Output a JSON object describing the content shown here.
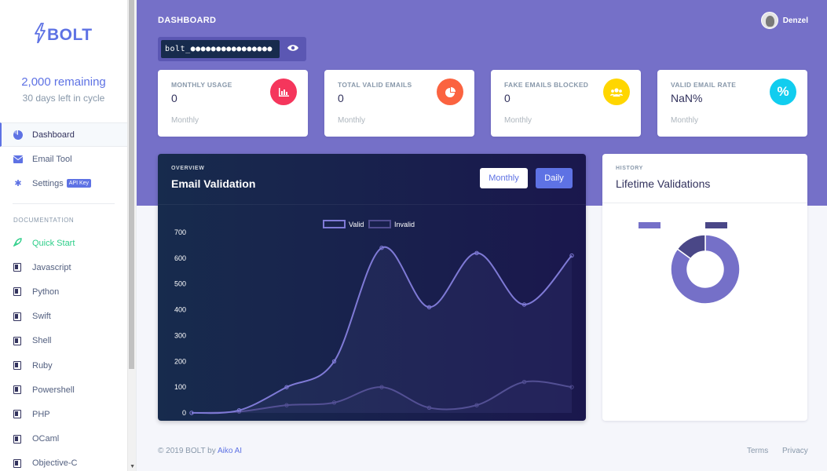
{
  "sidebar": {
    "logo_text": "BOLT",
    "remaining": "2,000 remaining",
    "cycle": "30 days left in cycle",
    "nav": [
      {
        "label": "Dashboard",
        "icon": "pie-chart-icon",
        "active": true
      },
      {
        "label": "Email Tool",
        "icon": "envelope-icon",
        "active": false
      },
      {
        "label": "Settings",
        "icon": "gear-icon",
        "active": false,
        "badge": "API Key"
      }
    ],
    "docs_heading": "DOCUMENTATION",
    "docs": [
      {
        "label": "Quick Start",
        "icon": "rocket-icon"
      },
      {
        "label": "Javascript",
        "icon": "book-icon"
      },
      {
        "label": "Python",
        "icon": "book-icon"
      },
      {
        "label": "Swift",
        "icon": "book-icon"
      },
      {
        "label": "Shell",
        "icon": "book-icon"
      },
      {
        "label": "Ruby",
        "icon": "book-icon"
      },
      {
        "label": "Powershell",
        "icon": "book-icon"
      },
      {
        "label": "PHP",
        "icon": "book-icon"
      },
      {
        "label": "OCaml",
        "icon": "book-icon"
      },
      {
        "label": "Objective-C",
        "icon": "book-icon"
      }
    ]
  },
  "header": {
    "title": "DASHBOARD",
    "user_name": "Denzel",
    "api_key_masked": "bolt_●●●●●●●●●●●●●●●●"
  },
  "stats": [
    {
      "label": "MONTHLY USAGE",
      "value": "0",
      "period": "Monthly",
      "icon": "bar-chart-icon",
      "color": "#f5365c"
    },
    {
      "label": "TOTAL VALID EMAILS",
      "value": "0",
      "period": "Monthly",
      "icon": "pie-chart-icon",
      "color": "#fb6340"
    },
    {
      "label": "FAKE EMAILS BLOCKED",
      "value": "0",
      "period": "Monthly",
      "icon": "users-icon",
      "color": "#ffd600"
    },
    {
      "label": "VALID EMAIL RATE",
      "value": "NaN%",
      "period": "Monthly",
      "icon": "percent-icon",
      "color": "#11cdef"
    }
  ],
  "overview": {
    "kicker": "OVERVIEW",
    "title": "Email Validation",
    "btn_monthly": "Monthly",
    "btn_daily": "Daily"
  },
  "history": {
    "kicker": "HISTORY",
    "title": "Lifetime Validations"
  },
  "chart_data": [
    {
      "type": "line",
      "title": "Email Validation",
      "ylim": [
        0,
        700
      ],
      "yticks": [
        0,
        100,
        200,
        300,
        400,
        500,
        600,
        700
      ],
      "x": [
        0,
        1,
        2,
        3,
        4,
        5,
        6,
        7,
        8
      ],
      "series": [
        {
          "name": "Valid",
          "color": "#7f7ad6",
          "values": [
            0,
            10,
            100,
            200,
            640,
            410,
            620,
            420,
            610
          ]
        },
        {
          "name": "Invalid",
          "color": "#504c8f",
          "values": [
            0,
            5,
            30,
            40,
            100,
            20,
            30,
            120,
            100
          ]
        }
      ],
      "grid": false,
      "legend": "top-center"
    },
    {
      "type": "pie",
      "title": "Lifetime Validations",
      "donut": true,
      "slices": [
        {
          "name": "",
          "value": 85,
          "color": "#7570c8"
        },
        {
          "name": "",
          "value": 15,
          "color": "#4a4787"
        }
      ]
    }
  ],
  "footer": {
    "copyright": "© 2019 BOLT by ",
    "brand": "Aiko AI",
    "terms": "Terms",
    "privacy": "Privacy"
  }
}
